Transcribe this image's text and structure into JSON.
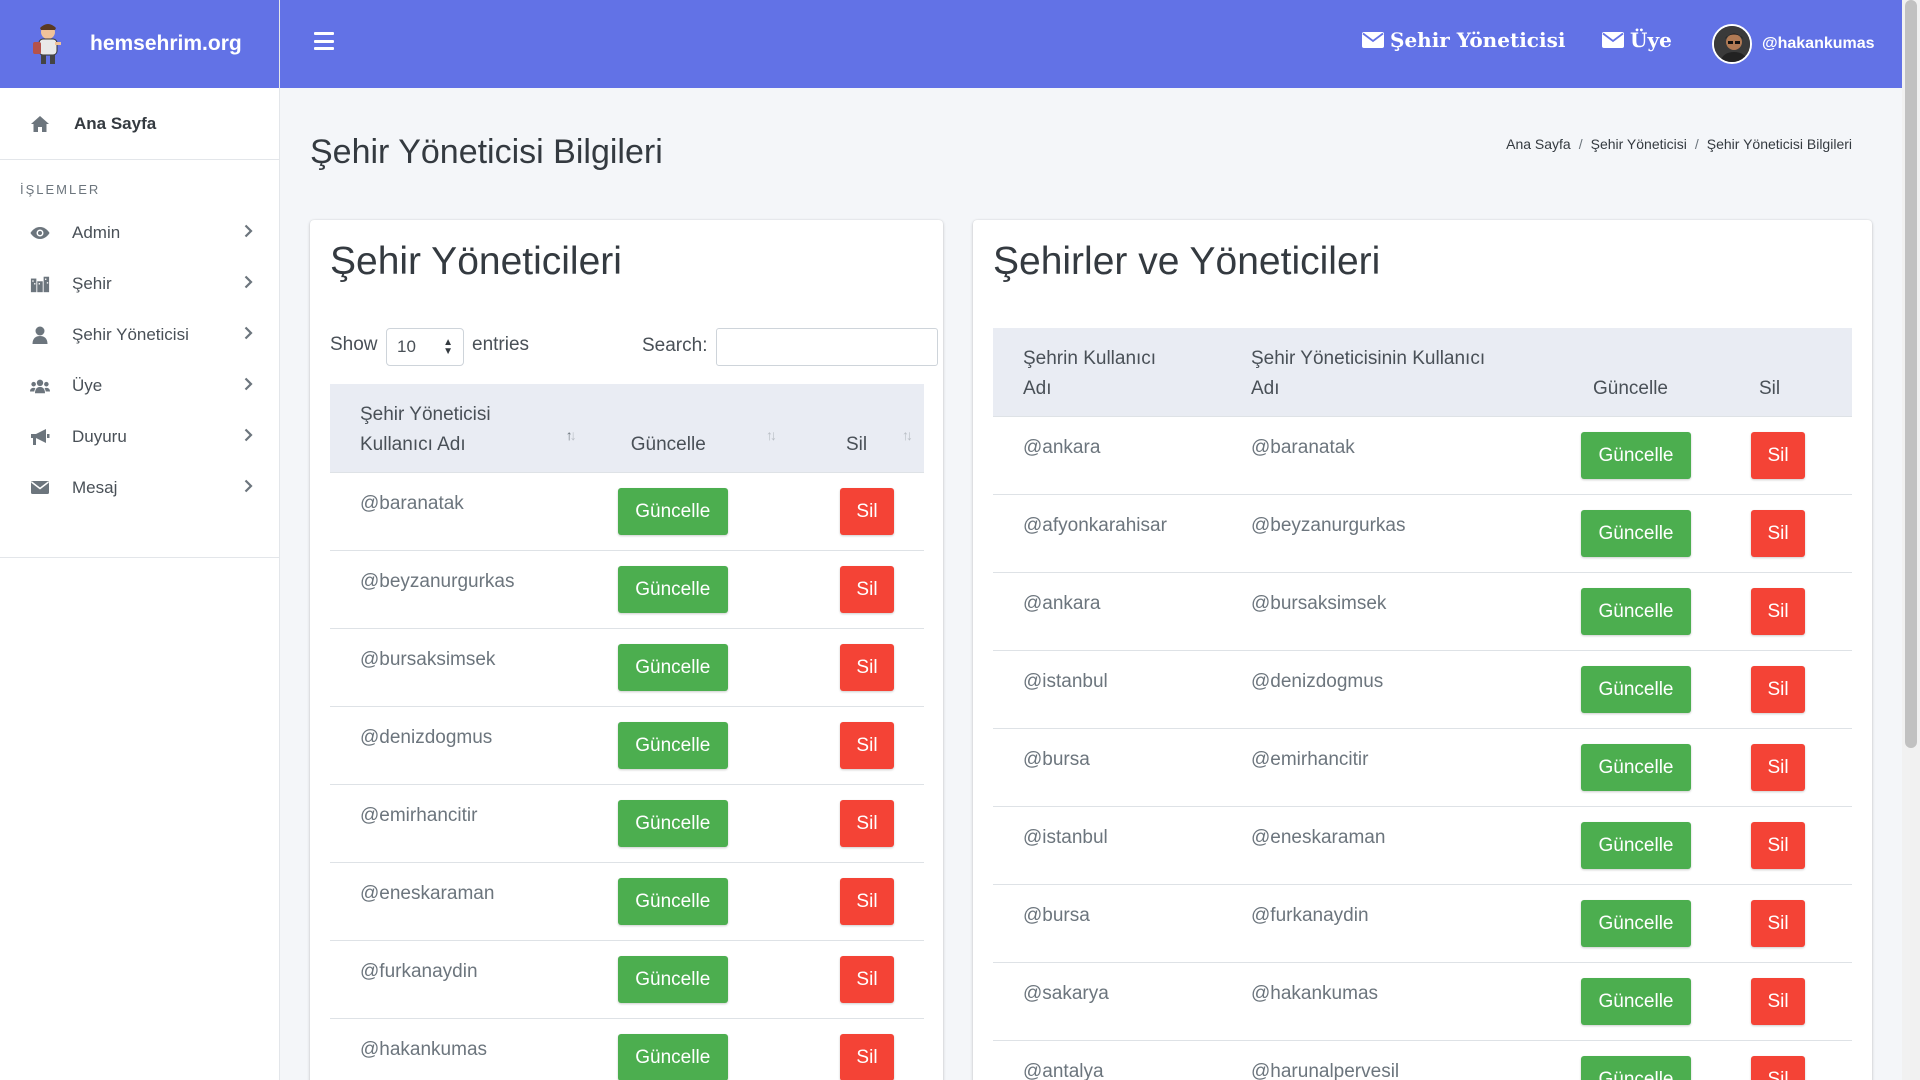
{
  "brand": {
    "name": "hemsehrim.org"
  },
  "sidebar": {
    "home": "Ana Sayfa",
    "section_title": "İŞLEMLER",
    "items": [
      {
        "label": "Admin",
        "icon": "eye-icon"
      },
      {
        "label": "Şehir",
        "icon": "city-icon"
      },
      {
        "label": "Şehir Yöneticisi",
        "icon": "user-icon"
      },
      {
        "label": "Üye",
        "icon": "users-icon"
      },
      {
        "label": "Duyuru",
        "icon": "megaphone-icon"
      },
      {
        "label": "Mesaj",
        "icon": "envelope-icon"
      }
    ]
  },
  "topbar": {
    "link1": "Şehir Yöneticisi",
    "link2": "Üye",
    "username": "@hakankumas"
  },
  "page": {
    "title": "Şehir Yöneticisi Bilgileri",
    "breadcrumb": [
      "Ana Sayfa",
      "Şehir Yöneticisi",
      "Şehir Yöneticisi Bilgileri"
    ]
  },
  "left_card": {
    "title": "Şehir Yöneticileri",
    "show_label": "Show",
    "entries_value": "10",
    "entries_label": "entries",
    "search_label": "Search:",
    "search_value": "",
    "columns": [
      "Şehir Yöneticisi Kullanıcı Adı",
      "Güncelle",
      "Sil"
    ],
    "update_label": "Güncelle",
    "delete_label": "Sil",
    "rows": [
      "@baranatak",
      "@beyzanurgurkas",
      "@bursaksimsek",
      "@denizdogmus",
      "@emirhancitir",
      "@eneskaraman",
      "@furkanaydin",
      "@hakankumas"
    ]
  },
  "right_card": {
    "title": "Şehirler ve Yöneticileri",
    "columns": [
      "Şehrin Kullanıcı Adı",
      "Şehir Yöneticisinin Kullanıcı Adı",
      "Güncelle",
      "Sil"
    ],
    "update_label": "Güncelle",
    "delete_label": "Sil",
    "rows": [
      [
        "@ankara",
        "@baranatak"
      ],
      [
        "@afyonkarahisar",
        "@beyzanurgurkas"
      ],
      [
        "@ankara",
        "@bursaksimsek"
      ],
      [
        "@istanbul",
        "@denizdogmus"
      ],
      [
        "@bursa",
        "@emirhancitir"
      ],
      [
        "@istanbul",
        "@eneskaraman"
      ],
      [
        "@bursa",
        "@furkanaydin"
      ],
      [
        "@sakarya",
        "@hakankumas"
      ],
      [
        "@antalya",
        "@harunalpervesil"
      ]
    ]
  },
  "colors": {
    "brand": "#6272e6",
    "success": "#4cae4f",
    "danger": "#f44336"
  }
}
